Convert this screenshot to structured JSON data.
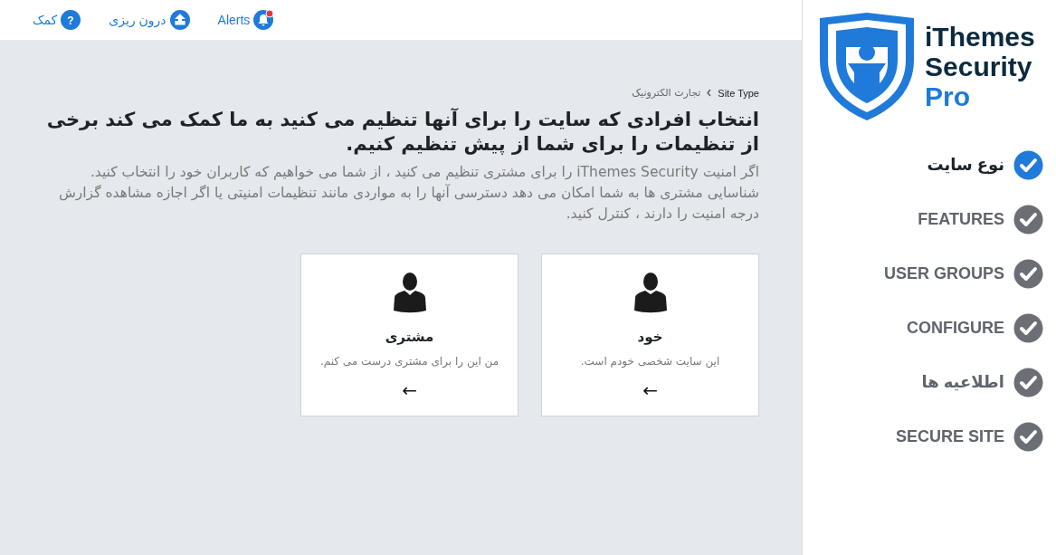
{
  "topbar": [
    {
      "kind": "alerts",
      "label": "Alerts",
      "unread": true
    },
    {
      "kind": "import",
      "label": "درون ریزی",
      "unread": false
    },
    {
      "kind": "help",
      "label": "کمک",
      "unread": false,
      "icon_text": "?"
    }
  ],
  "breadcrumb": [
    "Site Type",
    "تجارت الکترونیک"
  ],
  "heading": "انتخاب افرادی که سایت را برای آنها تنظیم می کنید به ما کمک می کند برخی از تنظیمات را برای شما از پیش تنظیم کنیم.",
  "description": "اگر امنیت iThemes Security را برای مشتری تنظیم می کنید ، از شما می خواهیم که کاربران خود را انتخاب کنید. شناسایی مشتری ها به شما امکان می دهد دسترسی آنها را به مواردی مانند تنظیمات امنیتی یا اگر اجازه مشاهده گزارش درجه امنیت را دارند ، کنترل کنید.",
  "cards": [
    {
      "kind": "personal",
      "title": "خود",
      "text": "این سایت شخصی خودم است.",
      "arrow": "←"
    },
    {
      "kind": "client",
      "title": "مشتری",
      "text": "من این را برای مشتری درست می کنم.",
      "arrow": "←"
    }
  ],
  "logo": {
    "line1": "iThemes",
    "line2": "Security",
    "line3": "Pro"
  },
  "steps": [
    {
      "label": "نوع سایت",
      "selected": true
    },
    {
      "label": "FEATURES",
      "selected": false
    },
    {
      "label": "USER GROUPS",
      "selected": false
    },
    {
      "label": "CONFIGURE",
      "selected": false
    },
    {
      "label": "اطلاعیه ها",
      "selected": false
    },
    {
      "label": "SECURE SITE",
      "selected": false
    }
  ]
}
